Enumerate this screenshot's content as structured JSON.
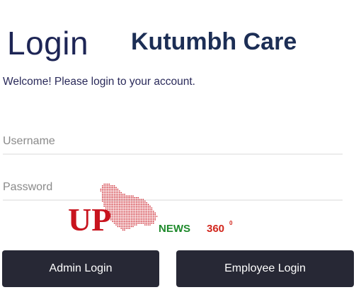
{
  "header": {
    "title": "Login",
    "brand": "Kutumbh Care"
  },
  "welcome_text": "Welcome! Please login to your account.",
  "form": {
    "username_placeholder": "Username",
    "password_placeholder": "Password"
  },
  "watermark": {
    "up_text": "UP",
    "news_text": "NEWS",
    "num_text": "360",
    "sup_text": "0",
    "colors": {
      "up": "#c8141e",
      "map": "#c8141e",
      "news": "#1f8a2c",
      "num": "#d2261c"
    }
  },
  "buttons": {
    "admin_label": "Admin Login",
    "employee_label": "Employee Login"
  },
  "colors": {
    "title": "#1d2555",
    "brand": "#1c2e55",
    "button_bg": "#272835",
    "button_text": "#ffffff",
    "field_underline": "#ececec"
  }
}
